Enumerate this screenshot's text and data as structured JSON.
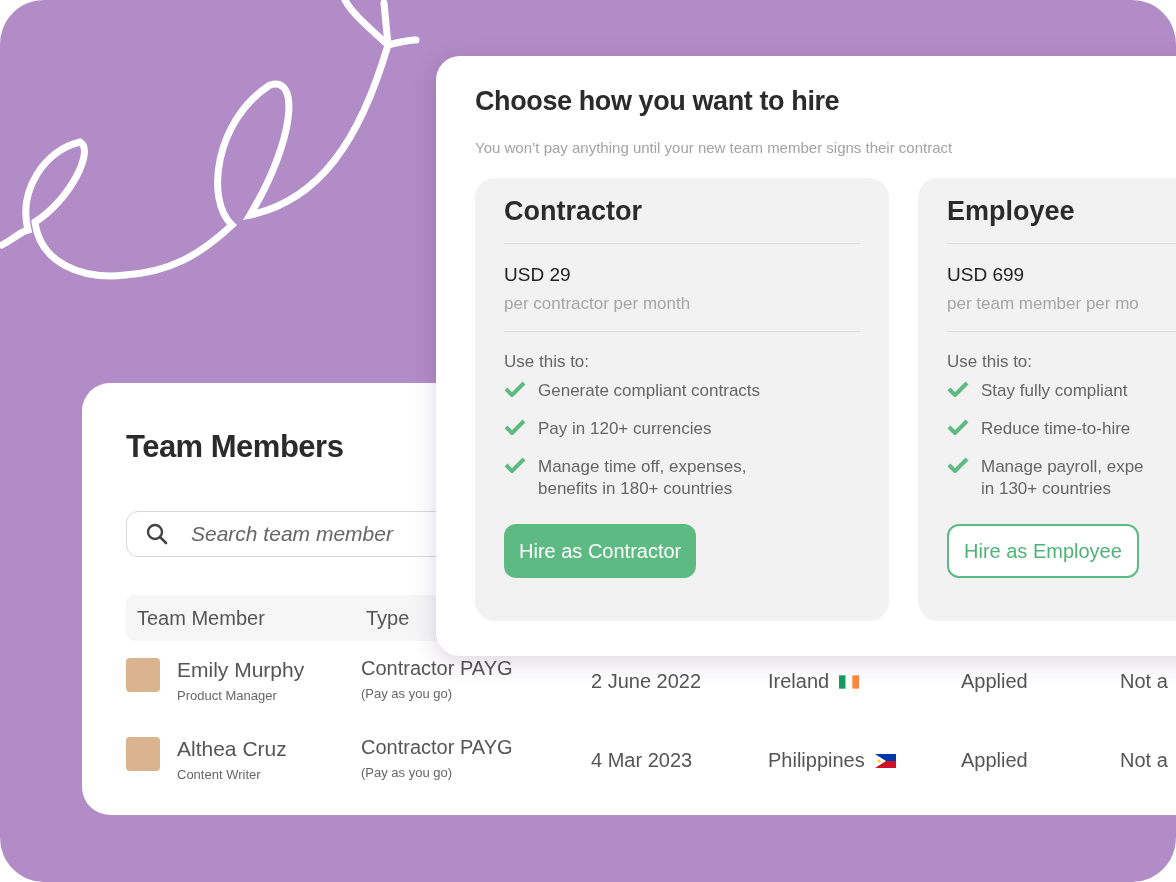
{
  "team_members": {
    "title": "Team Members",
    "search": {
      "placeholder": "Search team member"
    },
    "columns": [
      "Team Member",
      "Type"
    ],
    "rows": [
      {
        "name": "Emily Murphy",
        "role": "Product Manager",
        "type": "Contractor PAYG",
        "type_note": "(Pay as you go)",
        "date": "2 June 2022",
        "country": "Ireland",
        "flag": {
          "kind": "ireland"
        },
        "status": "Applied",
        "column_7": "Not a"
      },
      {
        "name": "Althea Cruz",
        "role": "Content Writer",
        "type": "Contractor PAYG",
        "type_note": "(Pay as you go)",
        "date": "4 Mar 2023",
        "country": "Philippines",
        "flag": {
          "kind": "philippines"
        },
        "status": "Applied",
        "column_7": "Not a"
      }
    ]
  },
  "hire_dialog": {
    "title": "Choose how you want to hire",
    "subtitle": "You won’t pay anything until your new team member signs their contract",
    "options": [
      {
        "title": "Contractor",
        "price": "USD 29",
        "price_note": "per contractor per month",
        "uses_label": "Use this to:",
        "uses": [
          "Generate compliant contracts",
          "Pay in 120+ currencies",
          "Manage time off, expenses,\nbenefits in 180+ countries"
        ],
        "button": {
          "label": "Hire as Contractor",
          "kind": "filled"
        }
      },
      {
        "title": "Employee",
        "price": "USD 699",
        "price_note": "per team member per mo",
        "uses_label": "Use this to:",
        "uses": [
          "Stay fully compliant",
          "Reduce time-to-hire",
          "Manage payroll, expe\nin 130+ countries"
        ],
        "button": {
          "label": "Hire as Employee",
          "kind": "outline"
        }
      }
    ]
  }
}
